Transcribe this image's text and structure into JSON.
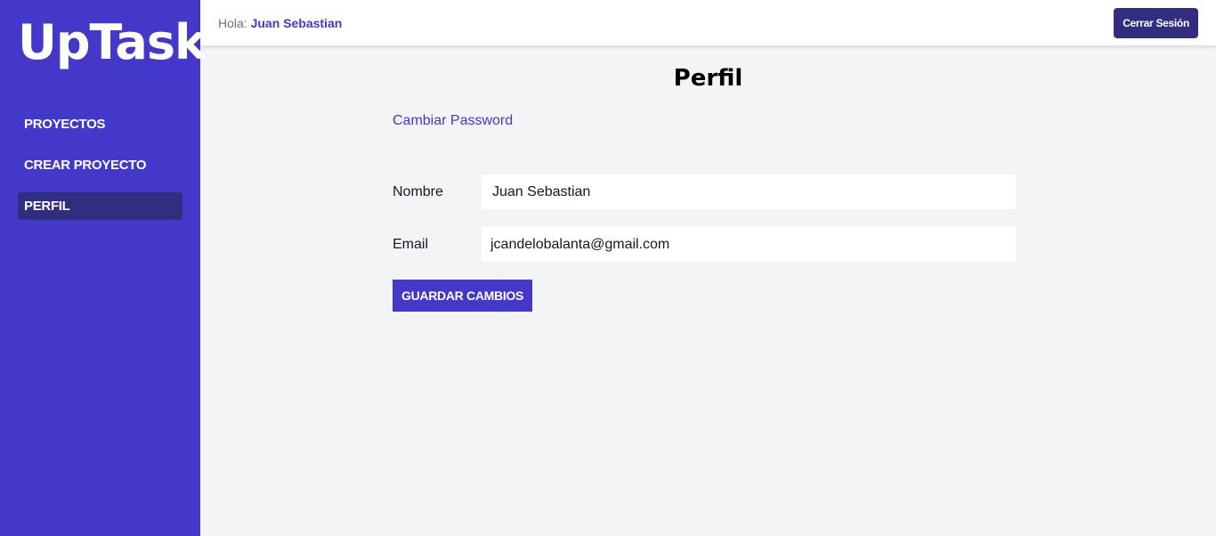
{
  "sidebar": {
    "logo": "UpTask",
    "items": [
      {
        "label": "PROYECTOS"
      },
      {
        "label": "CREAR PROYECTO"
      },
      {
        "label": "PERFIL"
      }
    ],
    "active_item": "PERFIL"
  },
  "topbar": {
    "greeting_prefix": "Hola:",
    "user_name": "Juan Sebastian",
    "logout_label": "Cerrar Sesión"
  },
  "main": {
    "title": "Perfil",
    "change_password_link": "Cambiar Password",
    "form": {
      "nombre_label": "Nombre",
      "nombre_value": "Juan Sebastian",
      "email_label": "Email",
      "email_value": "jcandelobalanta@gmail.com",
      "save_label": "GUARDAR CAMBIOS"
    }
  },
  "colors": {
    "sidebar_bg": "#4338ca",
    "active_bg": "#312e81",
    "page_bg": "#f3f4f6",
    "accent": "#4338ca"
  }
}
